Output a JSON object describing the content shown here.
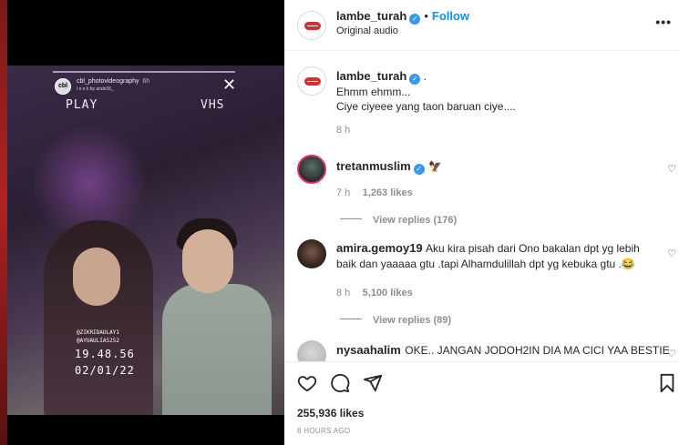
{
  "post": {
    "username": "lambe_turah",
    "follow_label": "Follow",
    "audio": "Original audio",
    "more_label": "•••",
    "caption_line1": "Ehmm ehmm...",
    "caption_line2": "Ciye ciyeee yang taon baruan ciye....",
    "caption_time": "8 h",
    "likes": "255,936 likes",
    "posted": "8 HOURS AGO"
  },
  "video": {
    "story_user": "cbl_photovideography",
    "story_time": "6h",
    "story_sub": "l o o k  by ando16_",
    "play_label": "PLAY",
    "vhs_label": "VHS",
    "tag1": "@ZIKRIDAULAY1",
    "tag2": "@AYUAULIA5252",
    "time": "19.48.56",
    "date": "02/01/22"
  },
  "comments": [
    {
      "username": "tretanmuslim",
      "text": "🦅",
      "time": "7 h",
      "likes": "1,263 likes",
      "replies": "View replies (176)"
    },
    {
      "username": "amira.gemoy19",
      "text_line1": "Aku kira pisah dari Ono bakalan dpt yg lebih",
      "text_line2": "baik dan yaaaaa gtu .tapi Alhamdulillah dpt yg kebuka gtu .😂",
      "time": "8 h",
      "likes": "5,100 likes",
      "replies": "View replies (89)"
    },
    {
      "username": "nysaahalim",
      "text": "OKE.. JANGAN JODOH2IN DIA MA CICI YAA BESTIE"
    }
  ],
  "icons": {
    "heart": "heart-icon",
    "comment": "comment-icon",
    "share": "share-icon",
    "save": "bookmark-icon",
    "verified": "verified-badge-icon"
  },
  "colors": {
    "accent": "#0095f6",
    "verified": "#3897f0",
    "muted": "#8e8e8e"
  }
}
